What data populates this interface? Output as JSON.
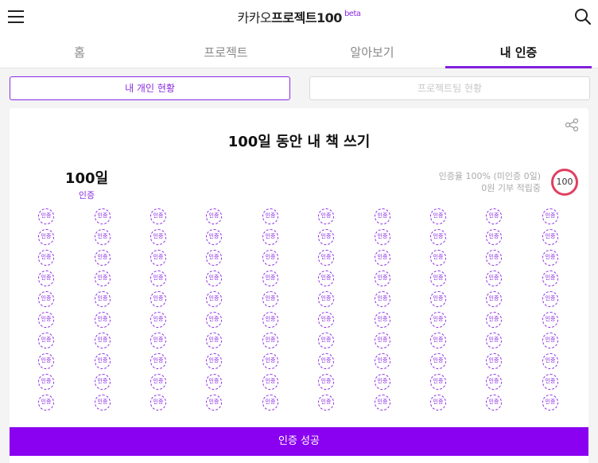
{
  "header": {
    "logo_prefix": "카카오",
    "logo_main": "프로젝트100",
    "logo_badge": "beta",
    "accent_color": "#8a2be2"
  },
  "tabs": [
    {
      "label": "홈",
      "active": false
    },
    {
      "label": "프로젝트",
      "active": false
    },
    {
      "label": "알아보기",
      "active": false
    },
    {
      "label": "내 인증",
      "active": true
    }
  ],
  "subtabs": [
    {
      "label": "내 개인 현황",
      "active": true
    },
    {
      "label": "프로젝트팀 현황",
      "active": false
    }
  ],
  "card": {
    "title": "100일 동안 내 책 쓰기",
    "days_count": "100일",
    "days_label": "인증",
    "rate_text": "인증율 100% (미인증 0일)",
    "donation_text": "0원 기부 적립중",
    "ring_value": "100",
    "ring_color": "#e04060",
    "badge_label": "인증",
    "badge_rows": 10,
    "badge_cols": 10
  },
  "action": {
    "success_label": "인증 성공",
    "color": "#8a00f0"
  }
}
